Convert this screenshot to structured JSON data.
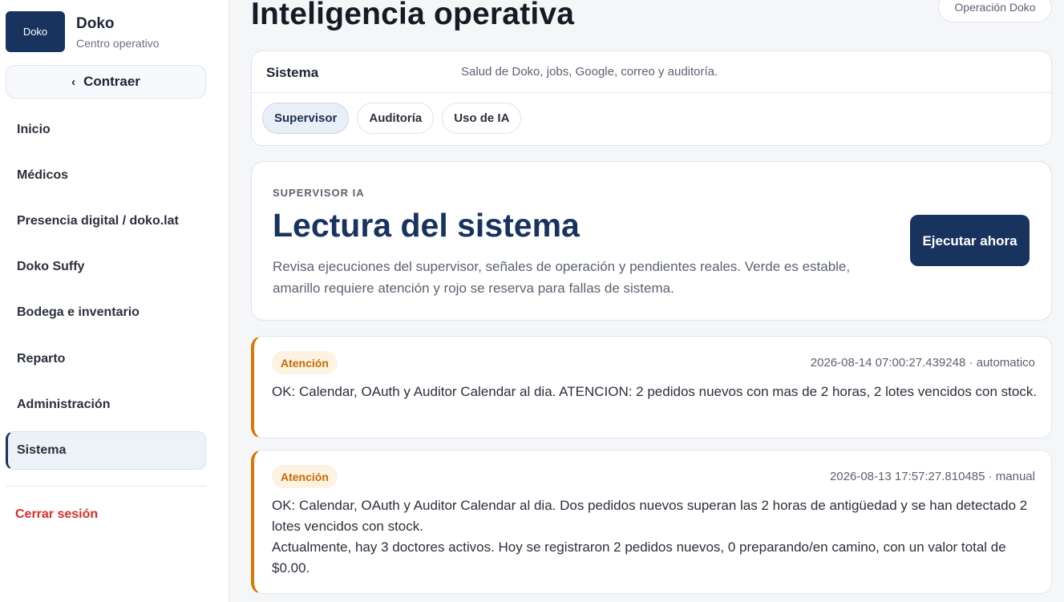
{
  "brand": {
    "logo_text": "Doko",
    "name": "Doko",
    "subtitle": "Centro operativo"
  },
  "sidebar": {
    "collapse_label": "Contraer",
    "items": [
      {
        "label": "Inicio"
      },
      {
        "label": "Médicos"
      },
      {
        "label": "Presencia digital / doko.lat"
      },
      {
        "label": "Doko Suffy"
      },
      {
        "label": "Bodega e inventario"
      },
      {
        "label": "Reparto"
      },
      {
        "label": "Administración"
      },
      {
        "label": "Sistema",
        "active": true
      }
    ],
    "logout_label": "Cerrar sesión"
  },
  "header": {
    "title": "Inteligencia operativa",
    "context_badge": "Operación Doko"
  },
  "system_panel": {
    "title": "Sistema",
    "description": "Salud de Doko, jobs, Google, correo y auditoría.",
    "tabs": [
      {
        "label": "Supervisor",
        "active": true
      },
      {
        "label": "Auditoría"
      },
      {
        "label": "Uso de IA"
      }
    ]
  },
  "hero": {
    "eyebrow": "SUPERVISOR IA",
    "title": "Lectura del sistema",
    "description": "Revisa ejecuciones del supervisor, señales de operación y pendientes reales. Verde es estable, amarillo requiere atención y rojo se reserva para fallas de sistema.",
    "run_button_label": "Ejecutar ahora"
  },
  "runs": [
    {
      "status": "Atención",
      "meta": "2026-08-14 07:00:27.439248 · automatico",
      "lines": [
        "OK: Calendar, OAuth y Auditor Calendar al dia. ATENCION: 2 pedidos nuevos con mas de 2 horas, 2 lotes vencidos con stock."
      ]
    },
    {
      "status": "Atención",
      "meta": "2026-08-13 17:57:27.810485 · manual",
      "lines": [
        "OK: Calendar, OAuth y Auditor Calendar al dia. Dos pedidos nuevos superan las 2 horas de antigüedad y se han detectado 2 lotes vencidos con stock.",
        "Actualmente, hay 3 doctores activos. Hoy se registraron 2 pedidos nuevos, 0 preparando/en camino, con un valor total de $0.00."
      ]
    }
  ],
  "colors": {
    "brand": "#17335e",
    "warning": "#d97706",
    "danger": "#d92d2d",
    "page_bg": "#f5f6f8"
  },
  "icons": {
    "collapse": "chevron-left-icon"
  }
}
